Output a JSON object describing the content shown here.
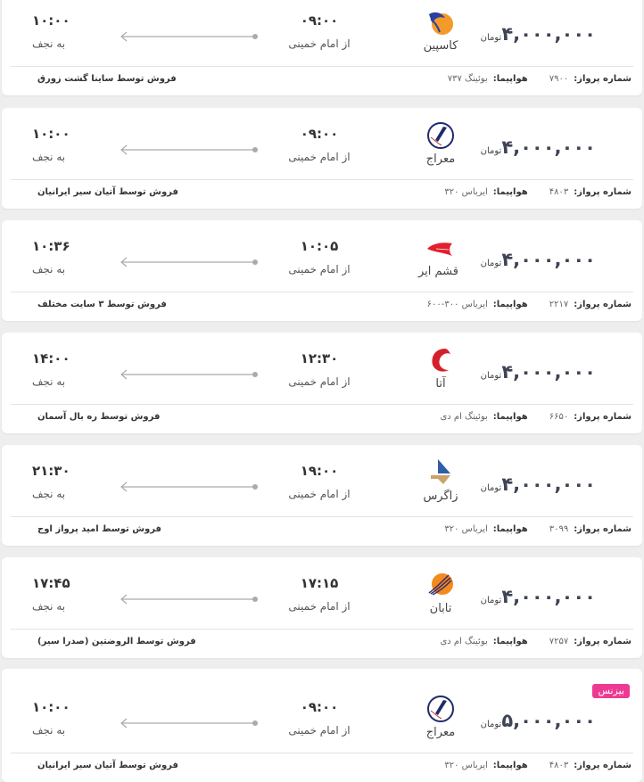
{
  "labels": {
    "currency": "تومان",
    "flight_number": "شماره پرواز:",
    "aircraft": "هواپیما:"
  },
  "flights": [
    {
      "price": "۴,۰۰۰,۰۰۰",
      "airline": "کاسپین",
      "logo": "caspian-logo",
      "dep_time": "۰۹:۰۰",
      "dep_place": "از امام خمینی",
      "arr_time": "۱۰:۰۰",
      "arr_place": "به نجف",
      "flight_no": "۷۹۰۰",
      "aircraft": "بوئینگ ۷۳۷",
      "seller": "فروش توسط ساینا گشت زورق",
      "badge": null
    },
    {
      "price": "۴,۰۰۰,۰۰۰",
      "airline": "معراج",
      "logo": "meraj-logo",
      "dep_time": "۰۹:۰۰",
      "dep_place": "از امام خمینی",
      "arr_time": "۱۰:۰۰",
      "arr_place": "به نجف",
      "flight_no": "۴۸۰۳",
      "aircraft": "ایرباس ۳۲۰",
      "seller": "فروش توسط آتیان سیر ایرانیان",
      "badge": null
    },
    {
      "price": "۴,۰۰۰,۰۰۰",
      "airline": "قشم ایر",
      "logo": "qeshm-air-logo",
      "dep_time": "۱۰:۰۵",
      "dep_place": "از امام خمینی",
      "arr_time": "۱۰:۳۶",
      "arr_place": "به نجف",
      "flight_no": "۲۲۱۷",
      "aircraft": "ایرباس ۳۰۰-۶۰۰",
      "seller": "فروش توسط ۳ سایت مختلف",
      "badge": null
    },
    {
      "price": "۴,۰۰۰,۰۰۰",
      "airline": "آتا",
      "logo": "ata-logo",
      "dep_time": "۱۲:۳۰",
      "dep_place": "از امام خمینی",
      "arr_time": "۱۴:۰۰",
      "arr_place": "به نجف",
      "flight_no": "۶۶۵۰",
      "aircraft": "بوئینگ ام دی",
      "seller": "فروش توسط ره بال آسمان",
      "badge": null
    },
    {
      "price": "۴,۰۰۰,۰۰۰",
      "airline": "زاگرس",
      "logo": "zagros-logo",
      "dep_time": "۱۹:۰۰",
      "dep_place": "از امام خمینی",
      "arr_time": "۲۱:۳۰",
      "arr_place": "به نجف",
      "flight_no": "۳۰۹۹",
      "aircraft": "ایرباس ۳۲۰",
      "seller": "فروش توسط امید پرواز اوج",
      "badge": null
    },
    {
      "price": "۴,۰۰۰,۰۰۰",
      "airline": "تابان",
      "logo": "taban-logo",
      "dep_time": "۱۷:۱۵",
      "dep_place": "از امام خمینی",
      "arr_time": "۱۷:۴۵",
      "arr_place": "به نجف",
      "flight_no": "۷۲۵۷",
      "aircraft": "بوئینگ ام دی",
      "seller": "فروش توسط الروضتین (صدرا سیر)",
      "badge": null
    },
    {
      "price": "۵,۰۰۰,۰۰۰",
      "airline": "معراج",
      "logo": "meraj-logo",
      "dep_time": "۰۹:۰۰",
      "dep_place": "از امام خمینی",
      "arr_time": "۱۰:۰۰",
      "arr_place": "به نجف",
      "flight_no": "۴۸۰۳",
      "aircraft": "ایرباس ۳۲۰",
      "seller": "فروش توسط آتیان سیر ایرانیان",
      "badge": "بیزنس"
    }
  ],
  "colors": {
    "badge": "#ee3a93",
    "price": "#3e4455"
  }
}
